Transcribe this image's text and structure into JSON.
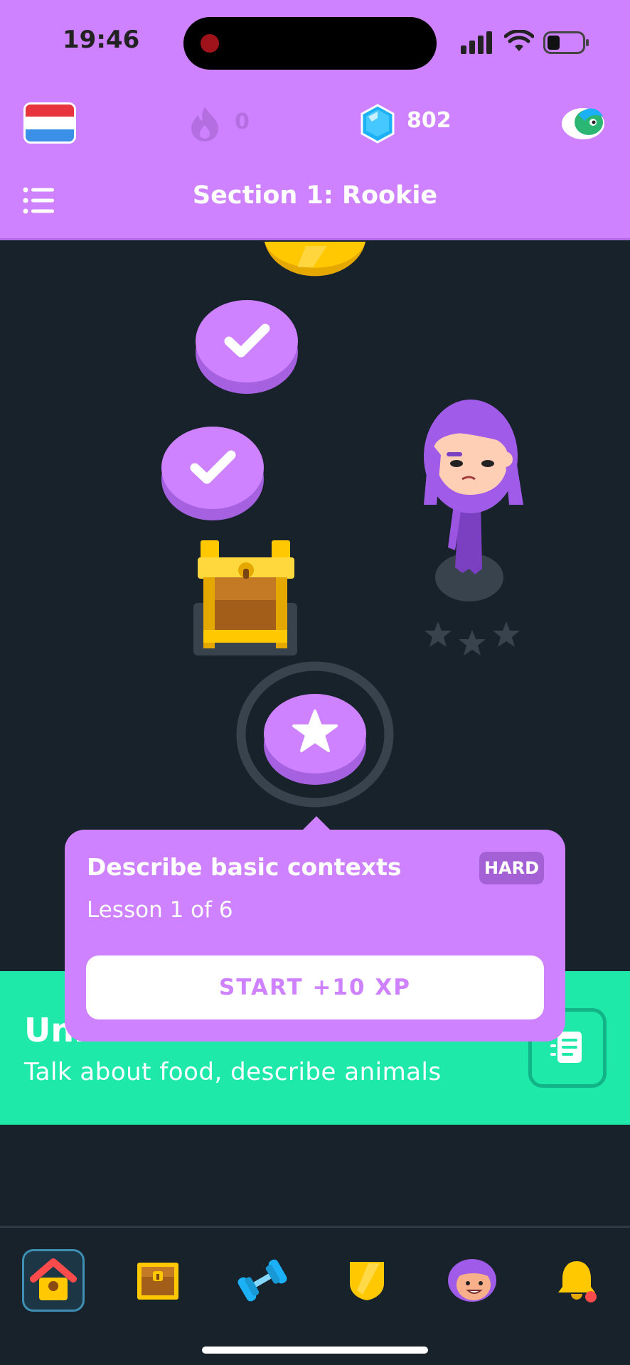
{
  "status_bar": {
    "time": "19:46"
  },
  "header": {
    "streak_count": "0",
    "gem_count": "802",
    "section_title": "Section 1: Rookie"
  },
  "path": {
    "nodes": [
      "completed-coin",
      "completed-lesson",
      "completed-lesson",
      "treasure-chest",
      "current-lesson"
    ],
    "character_stars": 3
  },
  "popover": {
    "title": "Describe basic contexts",
    "difficulty": "HARD",
    "progress": "Lesson 1 of 6",
    "start_label": "START +10 XP"
  },
  "unit": {
    "title": "Unit",
    "subtitle": "Talk about food, describe animals"
  },
  "bottom_nav": [
    "home-icon",
    "treasure-chest-icon",
    "dumbbell-icon",
    "league-shield-icon",
    "character-avatar-icon",
    "bell-icon"
  ],
  "colors": {
    "header_bg": "#ce82ff",
    "path_bg": "#18222b",
    "unit_banner": "#1ee9a9",
    "lesson_purple": "#ce82ff",
    "gem_blue": "#1cb0f6",
    "gold": "#ffc800"
  }
}
